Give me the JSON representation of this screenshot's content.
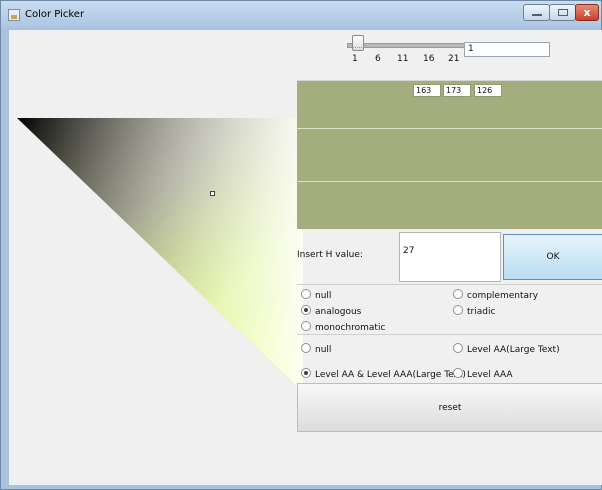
{
  "window": {
    "title": "Color Picker",
    "close_glyph": "x",
    "icons": {
      "app": "app-icon",
      "minimize": "minimize-icon",
      "maximize": "maximize-icon",
      "close": "close-icon"
    }
  },
  "slider": {
    "value": "1",
    "ticks": [
      "1",
      "6",
      "11",
      "16",
      "21"
    ]
  },
  "color": {
    "r": "163",
    "g": "173",
    "b": "126",
    "swatch_hex": "#a3ad7e"
  },
  "h_input": {
    "label": "Insert H value:",
    "value": "27",
    "ok_label": "OK"
  },
  "scheme": {
    "options": [
      {
        "label": "null",
        "checked": false
      },
      {
        "label": "complementary",
        "checked": false
      },
      {
        "label": "analogous",
        "checked": true
      },
      {
        "label": "triadic",
        "checked": false
      },
      {
        "label": "monochromatic",
        "checked": false
      }
    ]
  },
  "contrast": {
    "options": [
      {
        "label": "null",
        "checked": false
      },
      {
        "label": "Level AA(Large Text)",
        "checked": false
      },
      {
        "label": "Level AA & Level AAA(Large Text)",
        "checked": true
      },
      {
        "label": "Level AAA",
        "checked": false
      }
    ]
  },
  "actions": {
    "reset_label": "reset"
  }
}
